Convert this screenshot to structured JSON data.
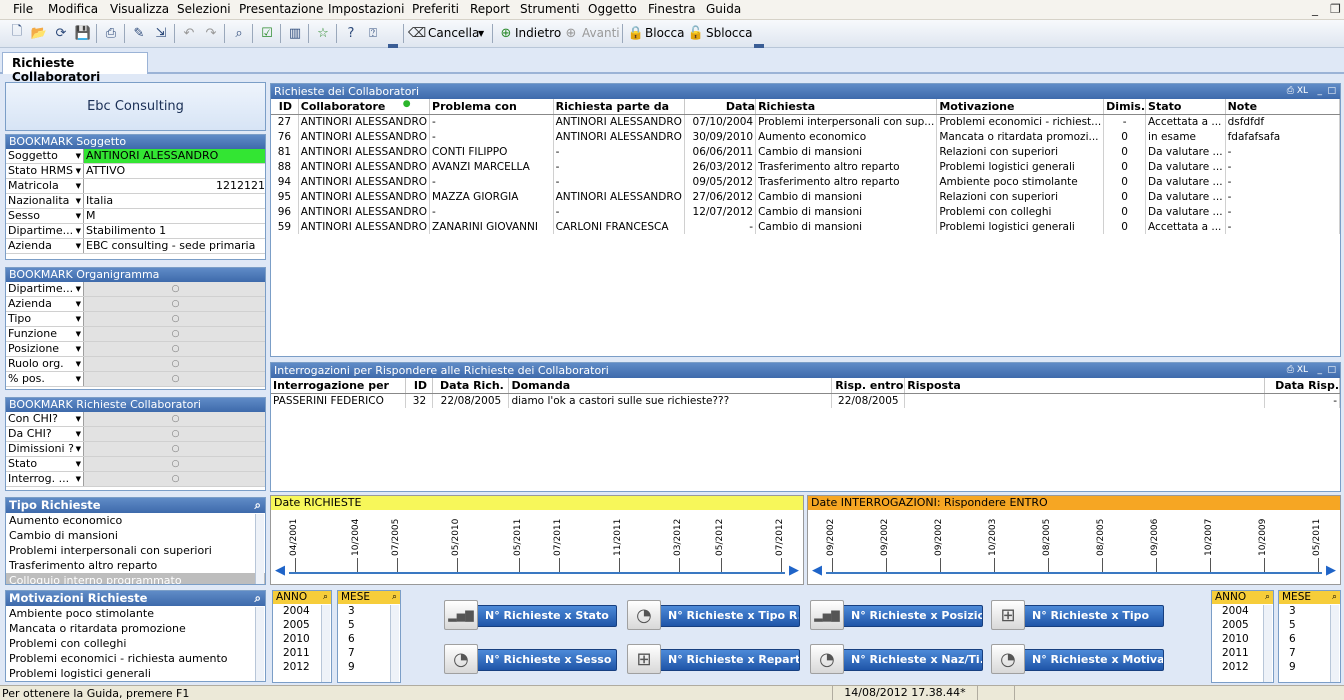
{
  "menu": [
    "File",
    "Modifica",
    "Visualizza",
    "Selezioni",
    "Presentazione",
    "Impostazioni",
    "Preferiti",
    "Report",
    "Strumenti",
    "Oggetto",
    "Finestra",
    "Guida"
  ],
  "toolbar": {
    "cancella": "Cancella",
    "indietro": "Indietro",
    "avanti": "Avanti",
    "blocca": "Blocca",
    "sblocca": "Sblocca"
  },
  "tab": "Richieste Collaboratori",
  "company": "Ebc Consulting",
  "bm_soggetto": {
    "title": "BOOKMARK Soggetto",
    "rows": [
      {
        "label": "Soggetto",
        "value": "ANTINORI ALESSANDRO"
      },
      {
        "label": "Stato HRMS",
        "value": "ATTIVO"
      },
      {
        "label": "Matricola",
        "value": "1212121"
      },
      {
        "label": "Nazionalita",
        "value": "Italia"
      },
      {
        "label": "Sesso",
        "value": "M"
      },
      {
        "label": "Dipartime...",
        "value": "Stabilimento 1"
      },
      {
        "label": "Azienda",
        "value": "EBC consulting - sede primaria"
      }
    ]
  },
  "bm_org": {
    "title": "BOOKMARK Organigramma",
    "rows": [
      "Dipartime...",
      "Azienda",
      "Tipo",
      "Funzione",
      "Posizione",
      "Ruolo org.",
      "% pos."
    ]
  },
  "bm_rich": {
    "title": "BOOKMARK Richieste Collaboratori",
    "rows": [
      "Con CHI?",
      "Da CHI?",
      "Dimissioni ?",
      "Stato",
      "Interrog. ..."
    ]
  },
  "tipo_richieste": {
    "title": "Tipo Richieste",
    "items": [
      "Aumento economico",
      "Cambio di mansioni",
      "Problemi interpersonali con superiori",
      "Trasferimento altro reparto",
      "Colloquio interno programmato"
    ]
  },
  "motivazioni": {
    "title": "Motivazioni Richieste",
    "items": [
      "Ambiente poco stimolante",
      "Mancata o ritardata promozione",
      "Problemi con colleghi",
      "Problemi economici - richiesta aumento",
      "Problemi logistici generali"
    ]
  },
  "richieste": {
    "title": "Richieste dei Collaboratori",
    "headers": [
      "ID",
      "Collaboratore",
      "Problema con",
      "Richiesta parte da",
      "Data",
      "Richiesta",
      "Motivazione",
      "Dimis.",
      "Stato",
      "Note"
    ],
    "rows": [
      [
        "27",
        "ANTINORI ALESSANDRO",
        "-",
        "ANTINORI ALESSANDRO",
        "07/10/2004",
        "Problemi interpersonali con sup...",
        "Problemi economici - richiest...",
        "-",
        "Accettata a ...",
        "dsfdfdf"
      ],
      [
        "76",
        "ANTINORI ALESSANDRO",
        "-",
        "ANTINORI ALESSANDRO",
        "30/09/2010",
        "Aumento economico",
        "Mancata o ritardata promozi...",
        "0",
        "in esame",
        "fdafafsafa"
      ],
      [
        "81",
        "ANTINORI ALESSANDRO",
        "CONTI FILIPPO",
        "-",
        "06/06/2011",
        "Cambio di mansioni",
        "Relazioni con superiori",
        "0",
        "Da valutare ...",
        "-"
      ],
      [
        "88",
        "ANTINORI ALESSANDRO",
        "AVANZI MARCELLA",
        "-",
        "26/03/2012",
        "Trasferimento altro reparto",
        "Problemi logistici generali",
        "0",
        "Da valutare ...",
        "-"
      ],
      [
        "94",
        "ANTINORI ALESSANDRO",
        "-",
        "-",
        "09/05/2012",
        "Trasferimento altro reparto",
        "Ambiente poco stimolante",
        "0",
        "Da valutare ...",
        "-"
      ],
      [
        "95",
        "ANTINORI ALESSANDRO",
        "MAZZA GIORGIA",
        "ANTINORI ALESSANDRO",
        "27/06/2012",
        "Cambio di mansioni",
        "Relazioni con superiori",
        "0",
        "Da valutare ...",
        "-"
      ],
      [
        "96",
        "ANTINORI ALESSANDRO",
        "-",
        "-",
        "12/07/2012",
        "Cambio di mansioni",
        "Problemi con colleghi",
        "0",
        "Da valutare ...",
        "-"
      ],
      [
        "59",
        "ANTINORI ALESSANDRO",
        "ZANARINI GIOVANNI",
        "CARLONI FRANCESCA",
        "-",
        "Cambio di mansioni",
        "Problemi logistici generali",
        "0",
        "Accettata a ...",
        "-"
      ]
    ]
  },
  "interrogazioni": {
    "title": "Interrogazioni per Rispondere alle Richieste dei Collaboratori",
    "headers": [
      "Interrogazione per",
      "ID",
      "Data Rich.",
      "Domanda",
      "Risp. entro",
      "Risposta",
      "Data Risp."
    ],
    "rows": [
      [
        "PASSERINI FEDERICO",
        "32",
        "22/08/2005",
        "diamo l'ok a castori sulle sue richieste???",
        "22/08/2005",
        "",
        "-"
      ]
    ]
  },
  "timeline_richieste": {
    "title": "Date RICHIESTE",
    "ticks": [
      "04/2001",
      "10/2004",
      "07/2005",
      "05/2010",
      "05/2011",
      "07/2011",
      "11/2011",
      "03/2012",
      "05/2012",
      "07/2012"
    ]
  },
  "timeline_interrog": {
    "title": "Date INTERROGAZIONI: Rispondere ENTRO",
    "ticks": [
      "09/2002",
      "09/2002",
      "09/2002",
      "10/2003",
      "08/2005",
      "08/2005",
      "09/2006",
      "10/2007",
      "10/2009",
      "05/2011"
    ]
  },
  "anno_label": "ANNO",
  "mese_label": "MESE",
  "anni": [
    "2004",
    "2005",
    "2010",
    "2011",
    "2012"
  ],
  "mesi": [
    "3",
    "5",
    "6",
    "7",
    "9"
  ],
  "buttons": [
    "N° Richieste x Stato",
    "N° Richieste x Tipo R...",
    "N° Richieste x Posizio...",
    "N° Richieste x Tipo",
    "N° Richieste x Sesso",
    "N° Richieste x Reparto",
    "N° Richieste x Naz/Ti...",
    "N° Richieste x Motiva..."
  ],
  "status": {
    "help": "Per ottenere la Guida, premere F1",
    "datetime": "14/08/2012 17.38.44*"
  }
}
